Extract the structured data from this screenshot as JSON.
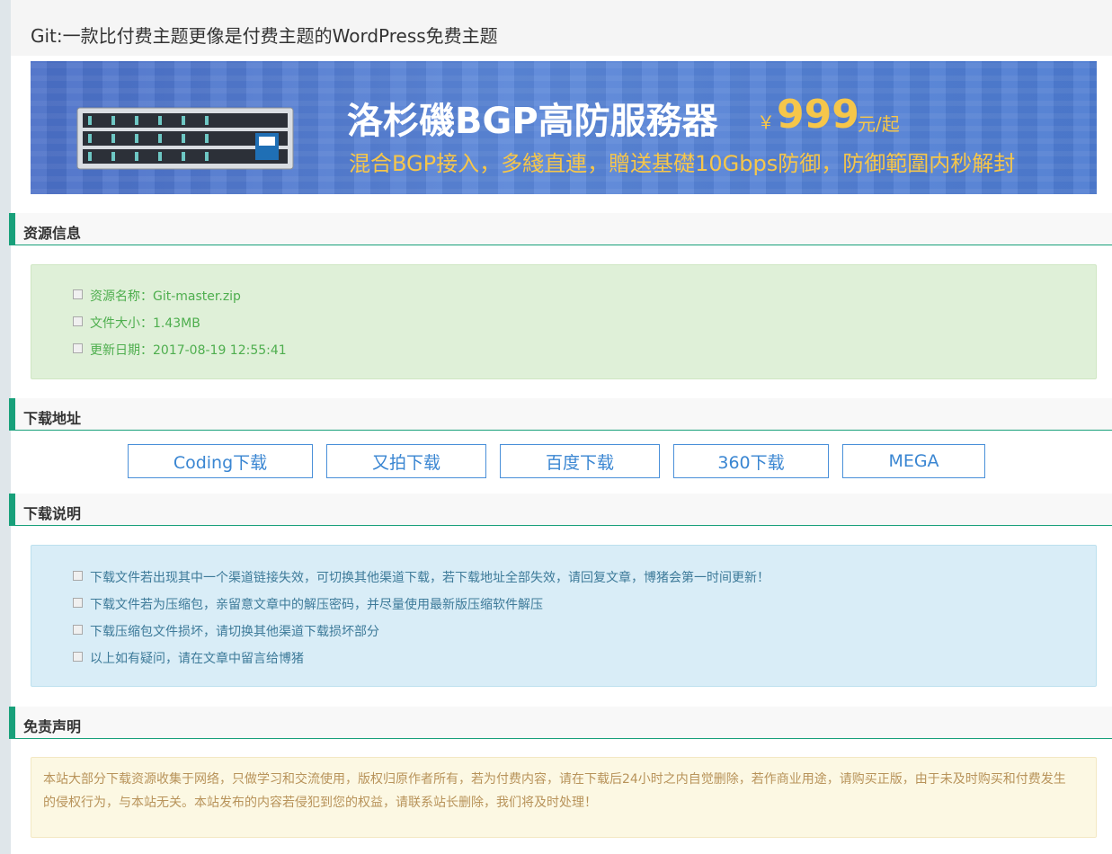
{
  "page": {
    "title": "Git:一款比付费主题更像是付费主题的WordPress免费主题"
  },
  "banner": {
    "headline": "洛杉磯BGP高防服務器",
    "price_symbol": "￥",
    "price": "999",
    "unit": "元/起",
    "subline": "混合BGP接入，多綫直連，贈送基礎10Gbps防御，防御範圍内秒解封",
    "image": "server-rack-image",
    "colors": {
      "background": "#4d7bd1",
      "headline": "#ffffff",
      "accent": "#f6c64a"
    }
  },
  "resource_info": {
    "header": "资源信息",
    "items": [
      {
        "text": "资源名称：Git-master.zip",
        "icon": "checkbox-icon"
      },
      {
        "text": "文件大小：1.43MB",
        "icon": "checkbox-icon"
      },
      {
        "text": "更新日期：2017-08-19 12:55:41",
        "icon": "checkbox-icon"
      }
    ]
  },
  "download": {
    "header": "下载地址",
    "buttons": [
      {
        "label": "Coding下载"
      },
      {
        "label": "又拍下载"
      },
      {
        "label": "百度下载"
      },
      {
        "label": "360下载"
      },
      {
        "label": "MEGA"
      }
    ]
  },
  "instructions": {
    "header": "下载说明",
    "items": [
      {
        "text": "下载文件若出现其中一个渠道链接失效，可切换其他渠道下载，若下载地址全部失效，请回复文章，博猪会第一时间更新！"
      },
      {
        "text": "下载文件若为压缩包，亲留意文章中的解压密码，并尽量使用最新版压缩软件解压"
      },
      {
        "text": "下载压缩包文件损坏，请切换其他渠道下载损坏部分"
      },
      {
        "text": "以上如有疑问，请在文章中留言给博猪"
      }
    ]
  },
  "disclaimer": {
    "header": "免责声明",
    "text": "本站大部分下载资源收集于网络，只做学习和交流使用，版权归原作者所有，若为付费内容，请在下载后24小时之内自觉删除，若作商业用途，请购买正版，由于未及时购买和付费发生的侵权行为，与本站无关。本站发布的内容若侵犯到您的权益，请联系站长删除，我们将及时处理！"
  },
  "theme": {
    "accent": "#18a07a",
    "button_text": "#3a86d2",
    "info_green": "#4eae4e",
    "info_blue": "#3d7a99",
    "warn_brown": "#b8935a"
  }
}
